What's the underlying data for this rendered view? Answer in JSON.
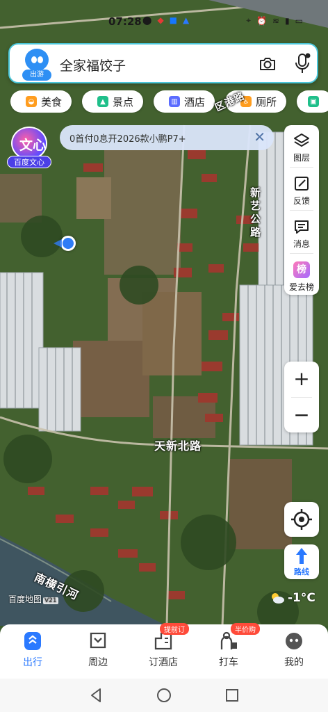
{
  "status_bar": {
    "time": "07:28",
    "icons": [
      "notification-icon",
      "app-badge-icon",
      "alipay-icon",
      "map-app-icon"
    ],
    "right_icons": [
      "location-icon",
      "alarm-icon",
      "vibrate-icon",
      "wifi-icon",
      "signal-icon",
      "battery-icon"
    ]
  },
  "search": {
    "logo_label": "出游",
    "query": "全家福饺子"
  },
  "chips": [
    {
      "label": "美食",
      "icon": "food-icon",
      "color": "#ff9d1f"
    },
    {
      "label": "景点",
      "icon": "scenic-icon",
      "color": "#1fbf8a"
    },
    {
      "label": "酒店",
      "icon": "hotel-icon",
      "color": "#5b6cff"
    },
    {
      "label": "厕所",
      "icon": "toilet-icon",
      "color": "#ff9d1f"
    },
    {
      "label": "",
      "icon": "bus-icon",
      "color": "#1fbf8a"
    }
  ],
  "promo": {
    "text": "0首付0息开2026款小鹏P7+"
  },
  "wenxin": {
    "big_text": "文心",
    "label": "百度文心"
  },
  "tools": [
    {
      "label": "图层",
      "icon": "layers-icon"
    },
    {
      "label": "反馈",
      "icon": "feedback-icon"
    },
    {
      "label": "消息",
      "icon": "message-icon"
    },
    {
      "label": "爱去榜",
      "icon": "ranking-icon",
      "badge": "榜"
    }
  ],
  "zoom": {
    "plus": "+",
    "minus": "−"
  },
  "route": {
    "label": "路线"
  },
  "map_labels": {
    "road_new_art": "新艺公路",
    "road_tianxin_north": "天新北路",
    "river_nanheng": "南横引河",
    "road_top": "区港路"
  },
  "watermark": {
    "text": "百度地图",
    "badge": "V21"
  },
  "weather": {
    "temp": "-1°C",
    "icon": "partly-cloudy-icon"
  },
  "bottom_nav": [
    {
      "label": "出行",
      "icon": "travel-icon",
      "active": true,
      "badge": ""
    },
    {
      "label": "周边",
      "icon": "nearby-icon",
      "active": false,
      "badge": ""
    },
    {
      "label": "订酒店",
      "icon": "hotel-booking-icon",
      "active": false,
      "badge": "提前订"
    },
    {
      "label": "打车",
      "icon": "taxi-icon",
      "active": false,
      "badge": "半价购"
    },
    {
      "label": "我的",
      "icon": "profile-icon",
      "active": false,
      "badge": ""
    }
  ],
  "colors": {
    "accent": "#2a79ff",
    "badge_red": "#ff4b3a",
    "location_dot": "#2f7cf6"
  }
}
